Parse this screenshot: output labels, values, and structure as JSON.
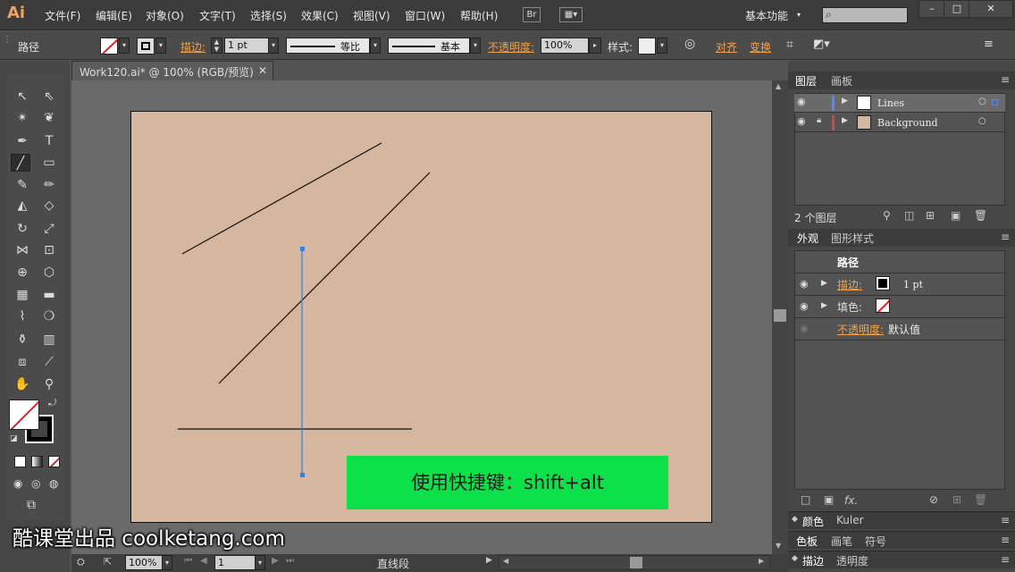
{
  "app": {
    "logo": "Ai"
  },
  "menu": [
    "文件(F)",
    "编辑(E)",
    "对象(O)",
    "文字(T)",
    "选择(S)",
    "效果(C)",
    "视图(V)",
    "窗口(W)",
    "帮助(H)"
  ],
  "menubar": {
    "br_label": "Br",
    "workspace": "基本功能",
    "search_placeholder": ""
  },
  "control": {
    "object_type": "路径",
    "stroke_label": "描边:",
    "stroke_weight": "1 pt",
    "profile_label": "等比",
    "brush_label": "基本",
    "opacity_label": "不透明度:",
    "opacity_value": "100%",
    "style_label": "样式:",
    "align_label": "对齐",
    "transform_label": "变换"
  },
  "document": {
    "tab_title": "Work120.ai* @ 100% (RGB/预览)",
    "close": "✕"
  },
  "layers_panel": {
    "tab_layers": "图层",
    "tab_artboards": "画板",
    "layers": [
      {
        "name": "Lines",
        "color": "#4a8cff"
      },
      {
        "name": "Background",
        "color": "#e04040"
      }
    ],
    "count_label": "2 个图层"
  },
  "appearance_panel": {
    "tab_appearance": "外观",
    "tab_graphic_styles": "图形样式",
    "title": "路径",
    "stroke_label": "描边:",
    "stroke_value": "1 pt",
    "fill_label": "填色:",
    "opacity_label": "不透明度:",
    "opacity_value": "默认值",
    "fx_label": "fx."
  },
  "bottom_panels": {
    "color": "颜色",
    "kuler": "Kuler",
    "swatches": "色板",
    "brushes": "画笔",
    "symbols": "符号",
    "stroke": "描边",
    "transparency": "透明度"
  },
  "status": {
    "zoom": "100%",
    "page": "1",
    "tool_name": "直线段"
  },
  "overlay": {
    "notice": "使用快捷键：shift+alt",
    "watermark": "酷课堂出品 coolketang.com"
  },
  "colors": {
    "accent_orange": "#f0a24e",
    "artboard": "#d5b7a0",
    "notice_green": "#0ce14a",
    "selection_blue": "#3a7de0"
  }
}
